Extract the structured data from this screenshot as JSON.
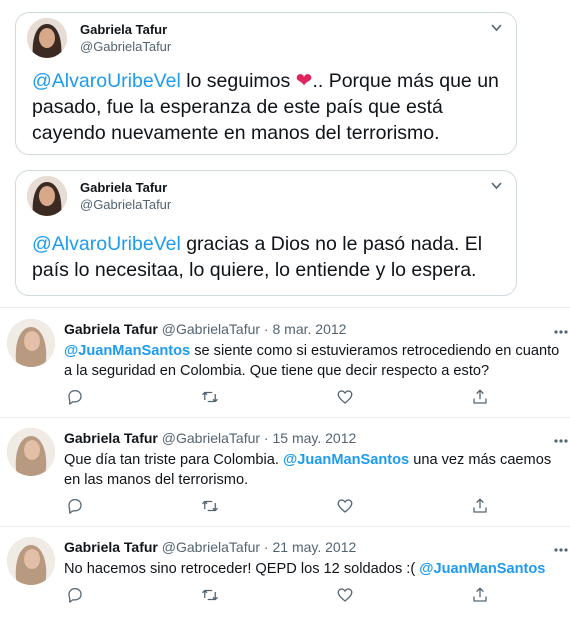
{
  "quoted": [
    {
      "name": "Gabriela Tafur",
      "handle": "@GabrielaTafur",
      "mention": "@AlvaroUribeVel",
      "text_a": " lo seguimos ",
      "text_b": ".. Porque más que un pasado, fue la esperanza de este país que está cayendo nuevamente en manos del terrorismo."
    },
    {
      "name": "Gabriela Tafur",
      "handle": "@GabrielaTafur",
      "mention": "@AlvaroUribeVel",
      "text_a": " gracias a Dios no le pasó nada. El país lo necesitaa, lo quiere, lo entiende y lo espera."
    }
  ],
  "tweets": [
    {
      "name": "Gabriela Tafur",
      "handle": "@GabrielaTafur",
      "date": "8 mar. 2012",
      "mention": "@JuanManSantos",
      "text_after": " se siente como si estuvieramos retrocediendo en cuanto a la seguridad en Colombia. Que tiene que decir respecto a esto?"
    },
    {
      "name": "Gabriela Tafur",
      "handle": "@GabrielaTafur",
      "date": "15 may. 2012",
      "text_before": "Que día tan triste para Colombia. ",
      "mention": "@JuanManSantos",
      "text_after": " una vez más caemos en las manos del terrorismo."
    },
    {
      "name": "Gabriela Tafur",
      "handle": "@GabrielaTafur",
      "date": "21 may. 2012",
      "text_before": "No hacemos sino retroceder! QEPD los 12 soldados :( ",
      "mention": "@JuanManSantos"
    }
  ],
  "separator": " · ",
  "icons": [
    "reply-icon",
    "retweet-icon",
    "like-icon",
    "share-icon",
    "more-icon",
    "chevron-down-icon",
    "heart-emoji-icon"
  ],
  "colors": {
    "accent": "#1d9bf0",
    "secondary_text": "#536471",
    "heart": "#e0245e",
    "border": "#cfd9de"
  }
}
